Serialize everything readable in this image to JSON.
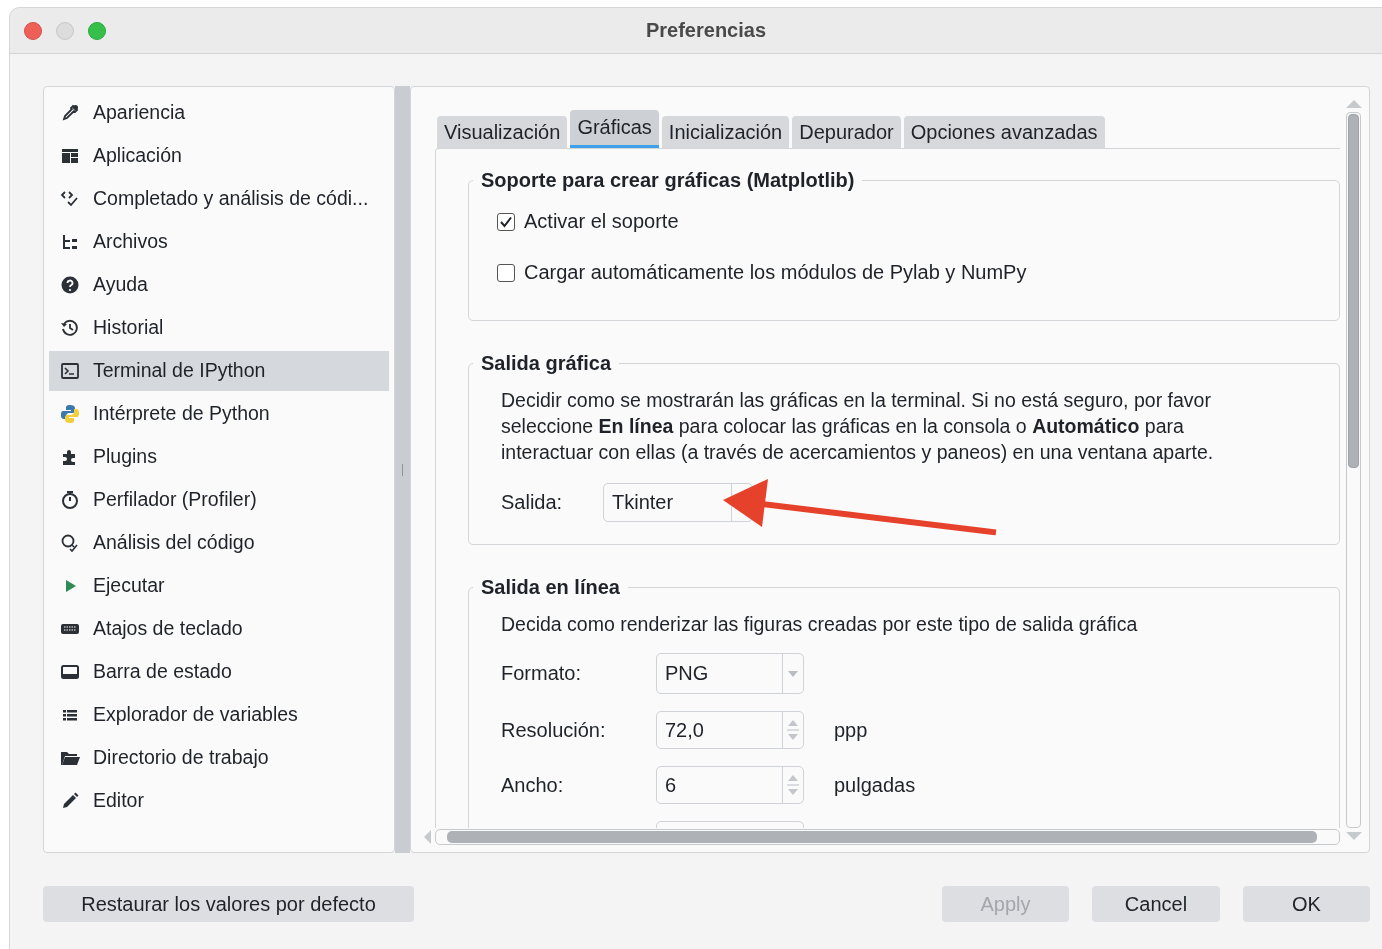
{
  "window": {
    "title": "Preferencias"
  },
  "sidebar": {
    "items": [
      {
        "label": "Apariencia",
        "selected": false
      },
      {
        "label": "Aplicación",
        "selected": false
      },
      {
        "label": "Completado y análisis de códi...",
        "selected": false
      },
      {
        "label": "Archivos",
        "selected": false
      },
      {
        "label": "Ayuda",
        "selected": false
      },
      {
        "label": "Historial",
        "selected": false
      },
      {
        "label": "Terminal de IPython",
        "selected": true
      },
      {
        "label": "Intérprete de Python",
        "selected": false
      },
      {
        "label": "Plugins",
        "selected": false
      },
      {
        "label": "Perfilador (Profiler)",
        "selected": false
      },
      {
        "label": "Análisis del código",
        "selected": false
      },
      {
        "label": "Ejecutar",
        "selected": false
      },
      {
        "label": "Atajos de teclado",
        "selected": false
      },
      {
        "label": "Barra de estado",
        "selected": false
      },
      {
        "label": "Explorador de variables",
        "selected": false
      },
      {
        "label": "Directorio de trabajo",
        "selected": false
      },
      {
        "label": "Editor",
        "selected": false
      }
    ]
  },
  "tabs": [
    {
      "label": "Visualización",
      "selected": false
    },
    {
      "label": "Gráficas",
      "selected": true
    },
    {
      "label": "Inicialización",
      "selected": false
    },
    {
      "label": "Depurador",
      "selected": false
    },
    {
      "label": "Opciones avanzadas",
      "selected": false
    }
  ],
  "groups": [
    {
      "title": "Soporte para crear gráficas (Matplotlib)",
      "options": [
        {
          "label": "Activar el soporte",
          "checked": true
        },
        {
          "label": "Cargar automáticamente los módulos de Pylab y NumPy",
          "checked": false
        }
      ]
    },
    {
      "title": "Salida gráfica",
      "description": "Decidir como se mostrarán las gráficas en la terminal. Si no está seguro, por favor seleccione **En línea** para colocar las gráficas en la consola o **Automático** para interactuar con ellas (a través de acercamientos y paneos) en una ventana aparte.",
      "fields": [
        {
          "kind": "dropdown",
          "label": "Salida:",
          "value": "Tkinter"
        }
      ]
    },
    {
      "title": "Salida en línea",
      "description": "Decida como renderizar las figuras creadas por este tipo de salida gráfica",
      "fields": [
        {
          "kind": "dropdown",
          "label": "Formato:",
          "value": "PNG"
        },
        {
          "kind": "spin",
          "label": "Resolución:",
          "value": "72,0",
          "unit": "ppp"
        },
        {
          "kind": "spin",
          "label": "Ancho:",
          "value": "6",
          "unit": "pulgadas"
        }
      ]
    }
  ],
  "buttons": [
    {
      "label": "Restaurar los valores por defecto",
      "disabled": false
    },
    {
      "label": "Apply",
      "disabled": true
    },
    {
      "label": "Cancel",
      "disabled": false
    },
    {
      "label": "OK",
      "disabled": false
    }
  ]
}
